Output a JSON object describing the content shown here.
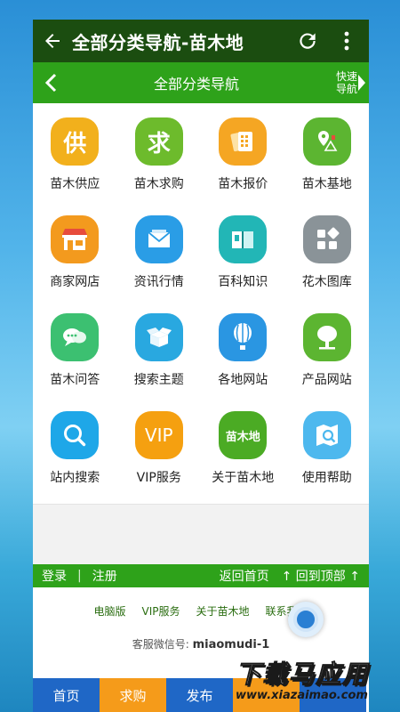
{
  "appbar": {
    "title": "全部分类导航-苗木地"
  },
  "subbar": {
    "title": "全部分类导航",
    "quick_line1": "快速",
    "quick_line2": "导航"
  },
  "grid": [
    {
      "label": "苗木供应",
      "glyph": "供",
      "color": "#f2b01c",
      "icon": "supply-icon"
    },
    {
      "label": "苗木求购",
      "glyph": "求",
      "color": "#6dbb2c",
      "icon": "purchase-icon"
    },
    {
      "label": "苗木报价",
      "glyph": "",
      "color": "#f5a623",
      "icon": "price-icon"
    },
    {
      "label": "苗木基地",
      "glyph": "",
      "color": "#5cb531",
      "icon": "base-map-icon"
    },
    {
      "label": "商家网店",
      "glyph": "",
      "color": "#f39a1e",
      "icon": "shop-icon"
    },
    {
      "label": "资讯行情",
      "glyph": "",
      "color": "#2a9de6",
      "icon": "news-mail-icon"
    },
    {
      "label": "百科知识",
      "glyph": "",
      "color": "#22b6b6",
      "icon": "encyclopedia-book-icon"
    },
    {
      "label": "花木图库",
      "glyph": "",
      "color": "#8a9398",
      "icon": "gallery-icon"
    },
    {
      "label": "苗木问答",
      "glyph": "",
      "color": "#3cc071",
      "icon": "qa-chat-icon"
    },
    {
      "label": "搜索主题",
      "glyph": "",
      "color": "#29a8e0",
      "icon": "topic-box-icon"
    },
    {
      "label": "各地网站",
      "glyph": "",
      "color": "#2a96e2",
      "icon": "balloon-icon"
    },
    {
      "label": "产品网站",
      "glyph": "",
      "color": "#5cb531",
      "icon": "tree-icon"
    },
    {
      "label": "站内搜索",
      "glyph": "",
      "color": "#1ea7e8",
      "icon": "search-icon"
    },
    {
      "label": "VIP服务",
      "glyph": "VIP",
      "color": "#f5a010",
      "icon": "vip-icon"
    },
    {
      "label": "关于苗木地",
      "glyph": "苗木地",
      "color": "#4bab24",
      "icon": "about-logo-icon"
    },
    {
      "label": "使用帮助",
      "glyph": "",
      "color": "#4db8ee",
      "icon": "help-map-icon"
    }
  ],
  "bottombar": {
    "login": "登录",
    "divider": "|",
    "register": "注册",
    "home": "返回首页",
    "top": "↑ 回到顶部 ↑"
  },
  "links": [
    "电脑版",
    "VIP服务",
    "关于苗木地",
    "联系我们"
  ],
  "service": {
    "label": "客服微信号:",
    "value": "miaomudi-1"
  },
  "tabs": [
    {
      "label": "首页",
      "color": "#1f67c6"
    },
    {
      "label": "求购",
      "color": "#f59b1a"
    },
    {
      "label": "发布",
      "color": "#1f67c6"
    },
    {
      "label": "",
      "color": "#f59b1a"
    },
    {
      "label": "",
      "color": "#1f67c6"
    }
  ],
  "watermark": {
    "big": "下载马应用",
    "small": "www.xiazaimao.com"
  }
}
